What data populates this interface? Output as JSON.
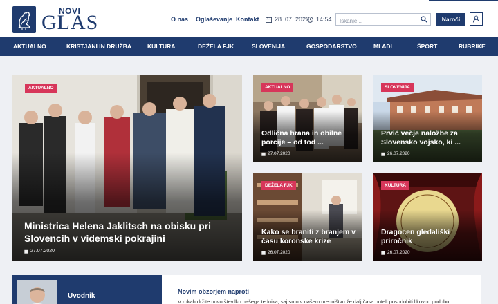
{
  "brand": {
    "small": "NOVI",
    "big": "GLAS"
  },
  "topnav": [
    {
      "label": "O nas"
    },
    {
      "label": "Oglaševanje"
    },
    {
      "label": "Kontakt"
    }
  ],
  "meta": {
    "date": "28. 07. 2020",
    "time": "14:54"
  },
  "search": {
    "placeholder": "Iskanje..."
  },
  "subscribe_label": "Naroči",
  "mainnav": [
    {
      "label": "AKTUALNO"
    },
    {
      "label": "KRISTJANI IN DRUŽBA"
    },
    {
      "label": "KULTURA"
    },
    {
      "label": "DEŽELA FJK"
    },
    {
      "label": "SLOVENIJA"
    },
    {
      "label": "GOSPODARSTVO"
    },
    {
      "label": "MLADI"
    },
    {
      "label": "ŠPORT"
    },
    {
      "label": "RUBRIKE"
    }
  ],
  "articles": [
    {
      "category": "AKTUALNO",
      "title": "Ministrica Helena Jaklitsch na obisku pri Slovencih v videmski pokrajini",
      "date": "27.07.2020"
    },
    {
      "category": "AKTUALNO",
      "title": "Odlična hrana in obilne porcije – od tod ...",
      "date": "27.07.2020"
    },
    {
      "category": "SLOVENIJA",
      "title": "Prvič večje naložbe za Slovensko vojsko, ki ...",
      "date": "26.07.2020"
    },
    {
      "category": "DEŽELA FJK",
      "title": "Kako se braniti z branjem v času koronske krize",
      "date": "26.07.2020"
    },
    {
      "category": "KULTURA",
      "title": "Dragocen gledališki priročnik",
      "date": "26.07.2020"
    }
  ],
  "editorial": {
    "label": "Uvodnik",
    "title": "Novim obzorjem naproti",
    "text": "V rokah držite novo številko našega tednika, saj smo v našem uredništvu že dalj časa hoteli posodobiti likovno podobo"
  },
  "colors": {
    "brand": "#1f3b6e",
    "badge": "#d7365a",
    "background": "#eef0f4"
  }
}
